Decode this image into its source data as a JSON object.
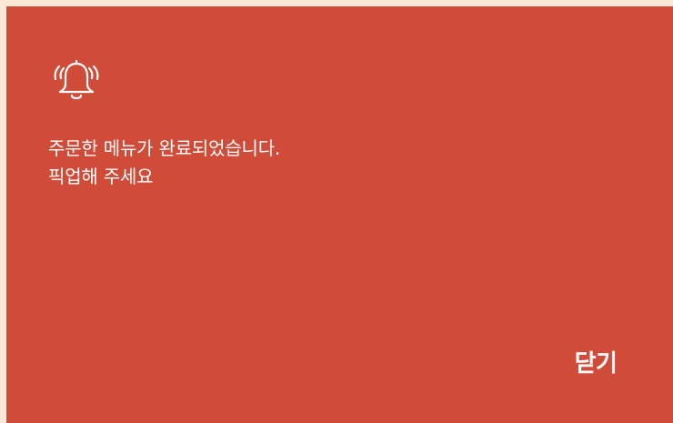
{
  "dialog": {
    "icon": "bell-ringing-icon",
    "message_line1": "주문한 메뉴가 완료되었습니다.",
    "message_line2": "픽업해 주세요",
    "close_label": "닫기"
  },
  "colors": {
    "background": "#fbe9d6",
    "dialog": "#d14b39",
    "text": "#ffffff"
  }
}
